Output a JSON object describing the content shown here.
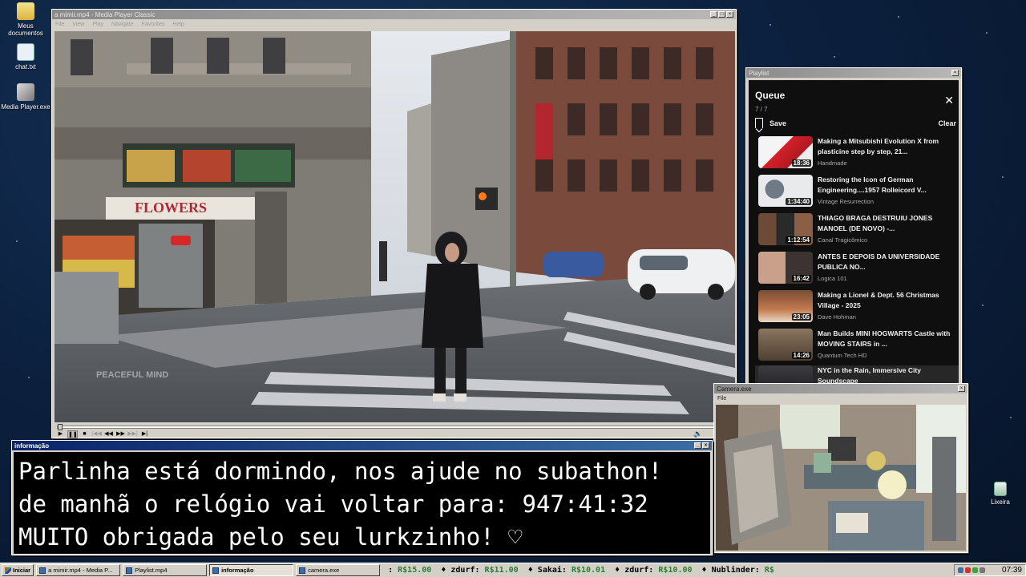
{
  "desktop": {
    "icons": [
      {
        "label": "Meus documentos",
        "icon": "folder-icon"
      },
      {
        "label": "chat.txt",
        "icon": "text-file-icon"
      },
      {
        "label": "Media Player.exe",
        "icon": "app-icon"
      },
      {
        "label": "Lixeira",
        "icon": "recycle-bin-icon"
      }
    ]
  },
  "player": {
    "title": "a mimir.mp4 - Media Player Classic",
    "menu": [
      "File",
      "View",
      "Play",
      "Navigate",
      "Favorites",
      "Help"
    ],
    "video_watermark": "PEACEFUL MIND",
    "progress": 0.0
  },
  "playlist": {
    "window_title": "Playlist",
    "heading": "Queue",
    "count": "7 / 7",
    "save_label": "Save",
    "clear_label": "Clear",
    "items": [
      {
        "title": "Making a Mitsubishi Evolution X from plasticine step by step, 21...",
        "channel": "Handmade",
        "duration": "18:36"
      },
      {
        "title": "Restoring the Icon of German Engineering....1957 Rolleicord V...",
        "channel": "Vintage Resurrection",
        "duration": "1:34:40"
      },
      {
        "title": "THIAGO BRAGA DESTRUIU JONES MANOEL (DE NOVO) -...",
        "channel": "Canal Tragicômico",
        "duration": "1:12:54"
      },
      {
        "title": "ANTES E DEPOIS DA UNIVERSIDADE PUBLICA NO...",
        "channel": "Logica 101",
        "duration": "16:42"
      },
      {
        "title": "Making a Lionel & Dept. 56 Christmas Village - 2025",
        "channel": "Dave Hohman",
        "duration": "23:05"
      },
      {
        "title": "Man Builds MINI HOGWARTS Castle with MOVING STAIRS in ...",
        "channel": "Quantum Tech HD",
        "duration": "14:26"
      },
      {
        "title": "NYC in the Rain, Immersive City Soundscape",
        "channel": "",
        "duration": ""
      }
    ]
  },
  "camera": {
    "title": "Camera.exe",
    "menu": "File"
  },
  "info": {
    "title": "informação",
    "lines": [
      "Parlinha está dormindo, nos ajude no subathon!",
      "de manhã o relógio vai voltar para:  947:41:32",
      "MUITO obrigada pelo seu lurkzinho! ♡"
    ]
  },
  "taskbar": {
    "start_label": "Iniciar",
    "tasks": [
      "a mimir.mp4 - Media P...",
      "Playlist.mp4",
      "informação",
      "camera.exe"
    ],
    "ticker": [
      {
        "name": "",
        "amount": "R$15.00"
      },
      {
        "name": "zdurf:",
        "amount": "R$11.00"
      },
      {
        "name": "Sakai:",
        "amount": "R$10.01"
      },
      {
        "name": "zdurf:",
        "amount": "R$10.00"
      },
      {
        "name": "Nublinder:",
        "amount": "R$"
      }
    ],
    "clock": "07:39"
  },
  "colors": {
    "title_active": "#0a246a",
    "window_face": "#d4d0c8",
    "queue_bg": "#0f0f0f",
    "money_green": "#2f7d32"
  }
}
